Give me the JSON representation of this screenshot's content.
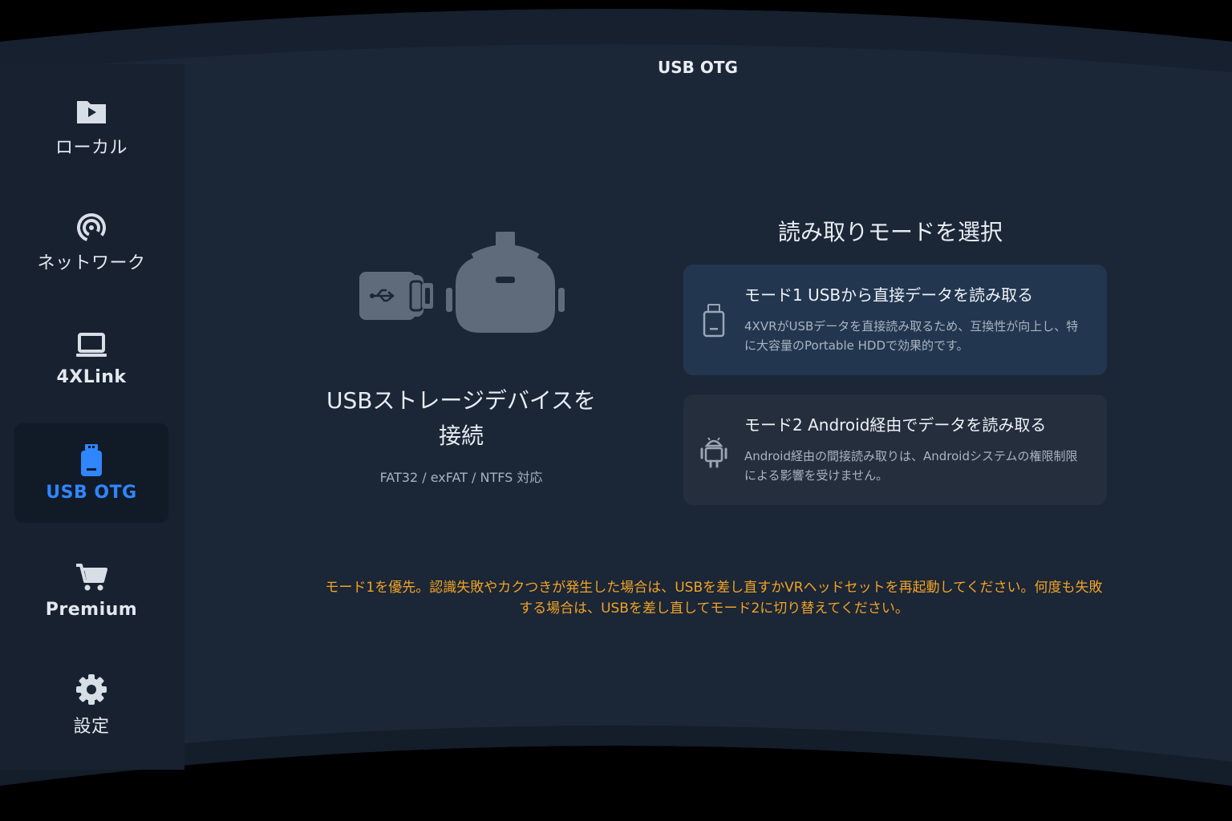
{
  "header": {
    "title": "USB OTG"
  },
  "sidebar": {
    "items": [
      {
        "label": "ローカル",
        "icon": "local-video-icon"
      },
      {
        "label": "ネットワーク",
        "icon": "network-icon"
      },
      {
        "label": "4XLink",
        "icon": "laptop-icon"
      },
      {
        "label": "USB OTG",
        "icon": "usb-icon",
        "active": true
      },
      {
        "label": "Premium",
        "icon": "cart-icon"
      },
      {
        "label": "設定",
        "icon": "gear-icon"
      }
    ]
  },
  "main": {
    "connect_title": "USBストレージデバイスを接続",
    "fs_note": "FAT32 / exFAT / NTFS 対応",
    "mode_heading": "読み取りモードを選択",
    "modes": [
      {
        "title": "モード1 USBから直接データを読み取る",
        "desc": "4XVRがUSBデータを直接読み取るため、互換性が向上し、特に大容量のPortable HDDで効果的です。",
        "icon": "usb-drive-icon"
      },
      {
        "title": "モード2 Android経由でデータを読み取る",
        "desc": "Android経由の間接読み取りは、Androidシステムの権限制限による影響を受けません。",
        "icon": "android-icon"
      }
    ],
    "warning": "モード1を優先。認識失敗やカクつきが発生した場合は、USBを差し直すかVRヘッドセットを再起動してください。何度も失敗する場合は、USBを差し直してモード2に切り替えてください。"
  },
  "colors": {
    "accent": "#2f86ff",
    "warning": "#f0a326",
    "panel": "#1b2636",
    "mode1_card": "#22364f",
    "mode2_card": "#242e3d"
  }
}
